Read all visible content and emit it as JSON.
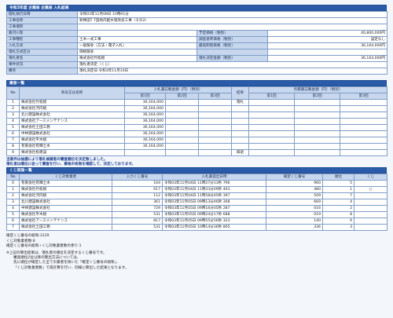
{
  "info": {
    "header": "令和3年度 企業局 企業局 入札結果",
    "rows": [
      {
        "label": "開札執行日時",
        "value": "令和03年11月08日 10時01分"
      },
      {
        "label": "工事名称",
        "value": "新棒田T T田地内配水管改良工事（その2）"
      },
      {
        "label": "工事場所",
        "value": ""
      }
    ],
    "pairs": [
      {
        "l1": "路河川等",
        "v1": "",
        "l2": "予定価格（税別）",
        "v2": "40,800,000円"
      },
      {
        "l1": "工事種別",
        "v1": "土木一式工事",
        "l2": "調査基準価格（税別）",
        "v2": "設定なし"
      },
      {
        "l1": "入札方式",
        "v1": "一般競争（方法・電子入札）",
        "l2": "最低制限価格（税別）",
        "v2": "36,164,000円"
      },
      {
        "l1": "落札方式区分",
        "v1": "価格競争",
        "l2": "",
        "v2": ""
      },
      {
        "l1": "落札者名",
        "v1": "株式会社竹松組",
        "l2": "落札決定金額（税別）",
        "v2": "36,164,000円"
      }
    ],
    "tail": [
      {
        "label": "事件状況",
        "value": "落札者決定（くじ）"
      },
      {
        "label": "備考",
        "value": "落札決定日:令和3年11月10日"
      }
    ]
  },
  "bidders": {
    "header": "業者一覧",
    "headers": {
      "no": "No",
      "name": "商号又は名称",
      "bid_group": "入札書記載金額（円）（税別）",
      "result": "結果",
      "loss_group": "見積書記載金額（円）（税別）",
      "r1": "第1回",
      "r2": "第2回",
      "r3": "第3回"
    },
    "rows": [
      {
        "no": "1",
        "name": "株式会社竹松組",
        "amount": "36,164,000",
        "result": "落札"
      },
      {
        "no": "2",
        "name": "株式会社河内組",
        "amount": "36,164,000",
        "result": ""
      },
      {
        "no": "3",
        "name": "北川建設株式会社",
        "amount": "36,164,000",
        "result": ""
      },
      {
        "no": "4",
        "name": "株式会社アースメンテナンス",
        "amount": "36,164,000",
        "result": ""
      },
      {
        "no": "5",
        "name": "株式会社土田工務",
        "amount": "36,164,000",
        "result": ""
      },
      {
        "no": "6",
        "name": "中林建設株式会社",
        "amount": "36,164,000",
        "result": ""
      },
      {
        "no": "7",
        "name": "株式会社平木組",
        "amount": "36,164,000",
        "result": ""
      },
      {
        "no": "8",
        "name": "有限会社有輝土木",
        "amount": "36,164,000",
        "result": ""
      },
      {
        "no": "9",
        "name": "株式会社松建設",
        "amount": "",
        "result": "辞退"
      }
    ]
  },
  "notice": [
    "当案件は抽選により落札候補者の審査順位を決定致しました。",
    "落札者は順位に従って審査を行い、資格の有無を確認して、決定しております。"
  ],
  "lottery": {
    "header": "くじ実施一覧",
    "headers": {
      "no": "No",
      "name": "くじ対象業者",
      "input": "入力くじ番号",
      "date": "入札書提出日時",
      "confirm": "確定くじ番号",
      "rank": "順位",
      "win": "くじ"
    },
    "rows": [
      {
        "no": "0",
        "name": "有限会社有輝土木",
        "input": "164",
        "date": "令和03年11月04日 11時27分13秒 796",
        "confirm": "960",
        "rank": "5",
        "win": ""
      },
      {
        "no": "1",
        "name": "株式会社竹松組",
        "input": "617",
        "date": "令和03年11月04日 11時33分09秒 463",
        "confirm": "480",
        "rank": "1",
        "win": "○"
      },
      {
        "no": "2",
        "name": "株式会社河内組",
        "input": "112",
        "date": "令和03年11月04日 11時58分45秒 397",
        "confirm": "509",
        "rank": "7",
        "win": ""
      },
      {
        "no": "3",
        "name": "北川建設株式会社",
        "input": "361",
        "date": "令和03年11月05日 09時13分46秒 308",
        "confirm": "669",
        "rank": "4",
        "win": ""
      },
      {
        "no": "4",
        "name": "中林建設株式会社",
        "input": "729",
        "date": "令和03年11月05日 09時16分05秒 287",
        "confirm": "016",
        "rank": "2",
        "win": ""
      },
      {
        "no": "5",
        "name": "株式会社平木組",
        "input": "531",
        "date": "令和03年11月05日 09時24分17秒 688",
        "confirm": "019",
        "rank": "8",
        "win": ""
      },
      {
        "no": "6",
        "name": "株式会社アースメンテナンス",
        "input": "817",
        "date": "令和03年11月05日 09時55分56秒 323",
        "confirm": "140",
        "rank": "6",
        "win": ""
      },
      {
        "no": "7",
        "name": "株式会社土田工務",
        "input": "531",
        "date": "令和03年11月05日 10時14分36秒 805",
        "confirm": "336",
        "rank": "3",
        "win": ""
      }
    ]
  },
  "footer": [
    "確定くじ番号の総和:3129",
    "くじ対象業者数:8",
    "確定くじ番号の総和÷くじ対象業者数の余り:1"
  ],
  "note": {
    "line1": "※上記の算出結果は、落札者の順位を決定するくじ番号です。",
    "line2": "審査順位2位以降の算出方法については、",
    "line3": "先に順位が確定した全ての業者を除いた「確定くじ番号の総和」、",
    "line4": "「くじ対象業者数」で再計算を行い、同様に算出した結果となります。"
  }
}
